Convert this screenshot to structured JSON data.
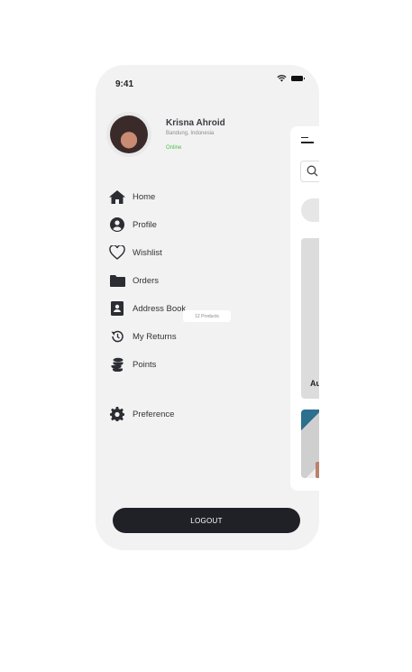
{
  "status_bar": {
    "time": "9:41"
  },
  "profile": {
    "name": "Krisna Ahroid",
    "location": "Bandung, Indonesia",
    "status": "Online"
  },
  "menu": {
    "home": "Home",
    "profile": "Profile",
    "wishlist": "Wishlist",
    "wishlist_badge": "12 Products",
    "orders": "Orders",
    "address_book": "Address Book",
    "my_returns": "My Returns",
    "points": "Points",
    "preference": "Preference"
  },
  "logout_label": "LOGOUT",
  "background_screen": {
    "card_label": "Au"
  },
  "colors": {
    "background": "#f2f2f2",
    "logout_button": "#1f2126",
    "online_status": "#4bbf4b"
  }
}
